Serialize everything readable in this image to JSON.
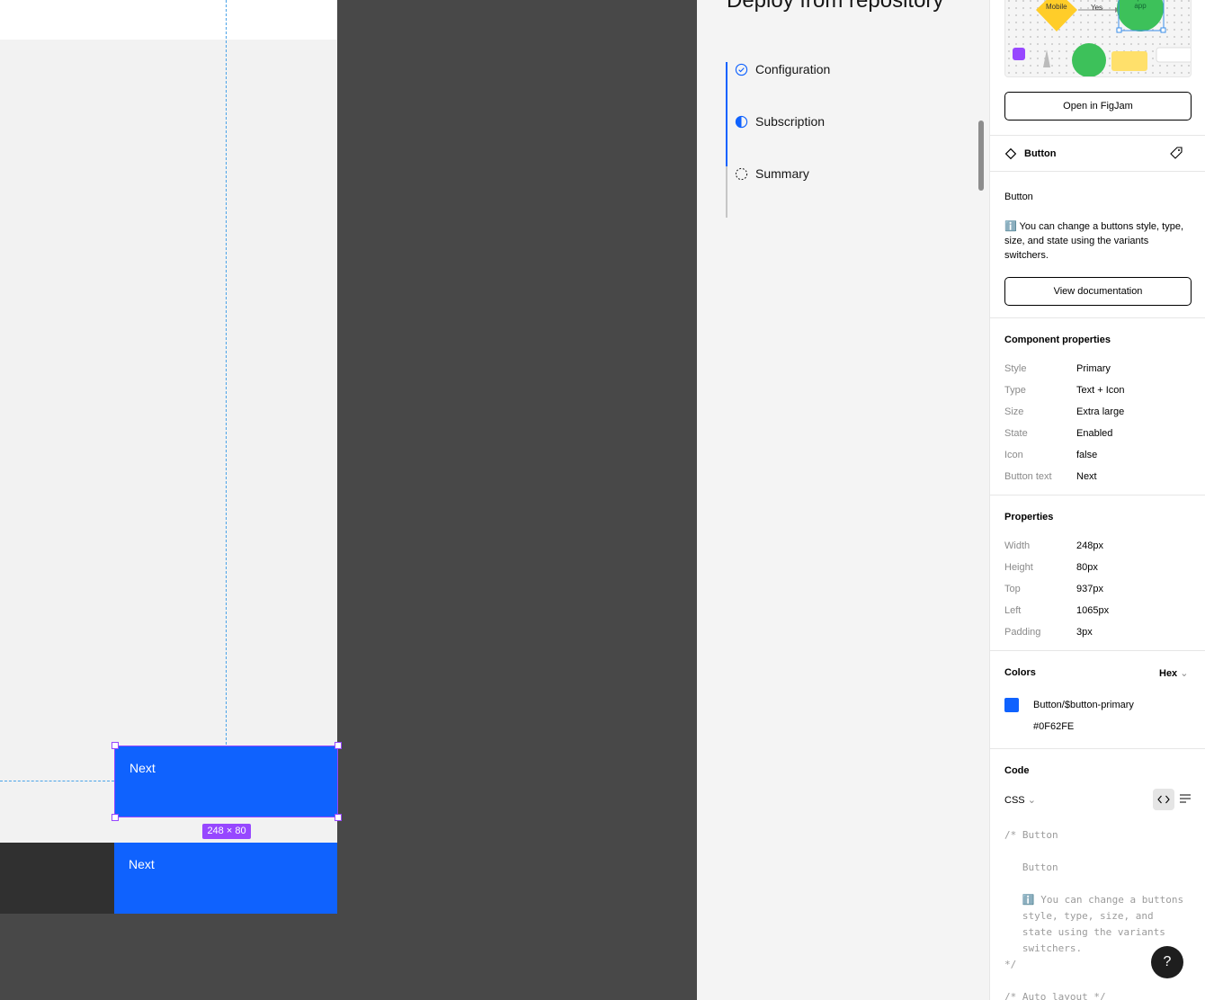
{
  "canvas": {
    "selected_button_text": "Next",
    "size_badge": "248 × 80",
    "preview_button_text": "Next",
    "deploy_title": "Deploy from repository",
    "steps": [
      {
        "label": "Configuration",
        "state": "complete"
      },
      {
        "label": "Subscription",
        "state": "current"
      },
      {
        "label": "Summary",
        "state": "incomplete"
      }
    ]
  },
  "inspector": {
    "figjam_thumb": {
      "mobile_label": "Mobile",
      "yes_label": "Yes",
      "open_app_label": "Open app"
    },
    "open_figjam_label": "Open in FigJam",
    "component_name": "Button",
    "description_title": "Button",
    "description_text": "ℹ️ You can change a buttons style, type, size, and state using the variants switchers.",
    "view_docs_label": "View documentation",
    "component_properties": {
      "title": "Component properties",
      "rows": [
        {
          "label": "Style",
          "value": "Primary"
        },
        {
          "label": "Type",
          "value": "Text + Icon"
        },
        {
          "label": "Size",
          "value": "Extra large"
        },
        {
          "label": "State",
          "value": "Enabled"
        },
        {
          "label": "Icon",
          "value": "false"
        },
        {
          "label": "Button text",
          "value": "Next"
        }
      ]
    },
    "properties": {
      "title": "Properties",
      "rows": [
        {
          "label": "Width",
          "value": "248px"
        },
        {
          "label": "Height",
          "value": "80px"
        },
        {
          "label": "Top",
          "value": "937px"
        },
        {
          "label": "Left",
          "value": "1065px"
        },
        {
          "label": "Padding",
          "value": "3px"
        }
      ]
    },
    "colors": {
      "title": "Colors",
      "format": "Hex",
      "token_name": "Button/$button-primary",
      "hex": "#0F62FE"
    },
    "code": {
      "title": "Code",
      "language": "CSS",
      "snippet": "/* Button\n\n   Button\n\n   ℹ️ You can change a buttons\n   style, type, size, and\n   state using the variants\n   switchers.\n*/\n\n/* Auto layout */"
    },
    "help_label": "?"
  },
  "colors": {
    "primary": "#0F62FE",
    "selection": "#9747ff",
    "guide": "#4aa3e8"
  }
}
